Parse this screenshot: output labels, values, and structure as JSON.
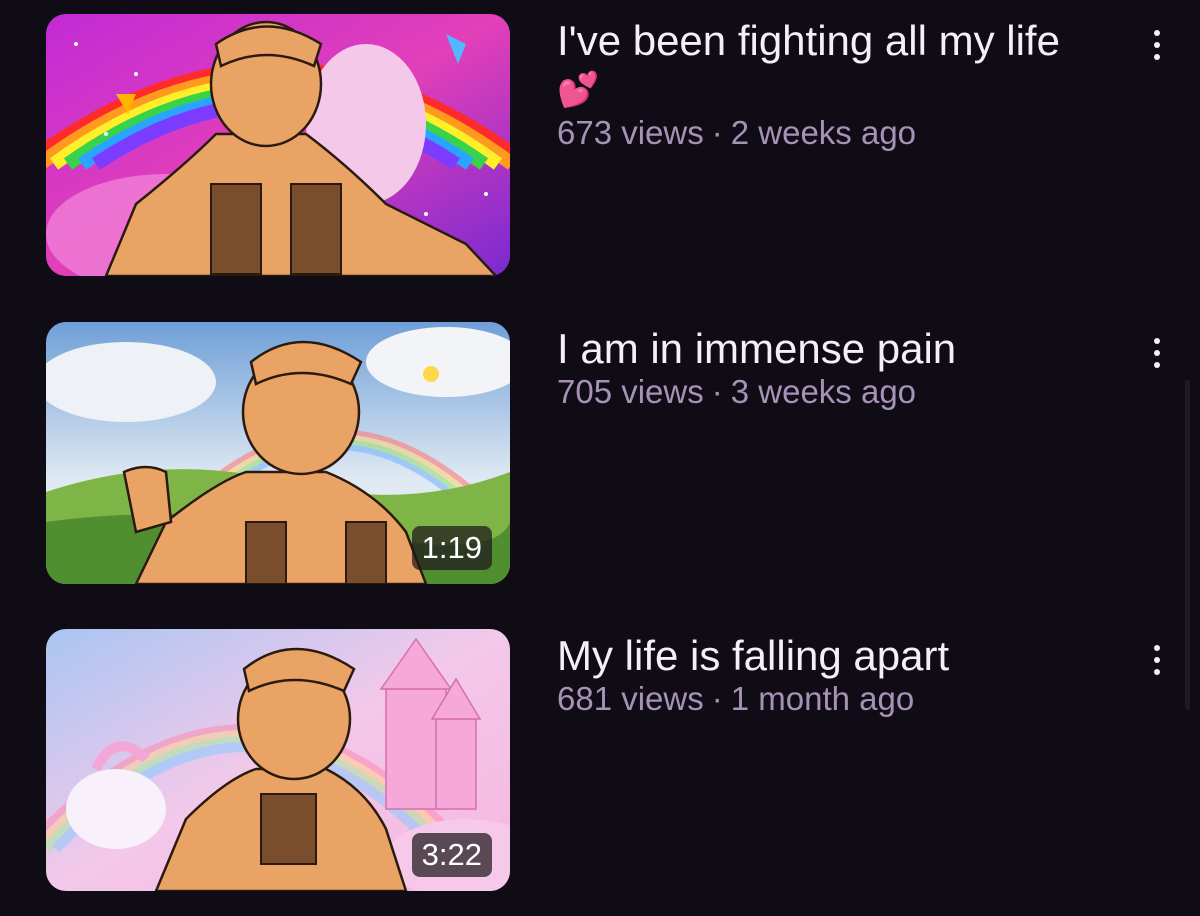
{
  "videos": [
    {
      "title": "I've been fighting all my life",
      "emoji": "💕",
      "views": "673 views",
      "age": "2 weeks ago",
      "duration": "",
      "theme": "rainbow-neon"
    },
    {
      "title": "I am in immense pain",
      "emoji": "",
      "views": "705 views",
      "age": "3 weeks ago",
      "duration": "1:19",
      "theme": "meadow"
    },
    {
      "title": "My life is falling apart",
      "emoji": "",
      "views": "681 views",
      "age": "1 month ago",
      "duration": "3:22",
      "theme": "pastel-castle"
    }
  ],
  "separator": "·",
  "colors": {
    "background": "#100c16",
    "title": "#f3f0f6",
    "subtitle": "#a592b6",
    "character": "#e9a465"
  }
}
